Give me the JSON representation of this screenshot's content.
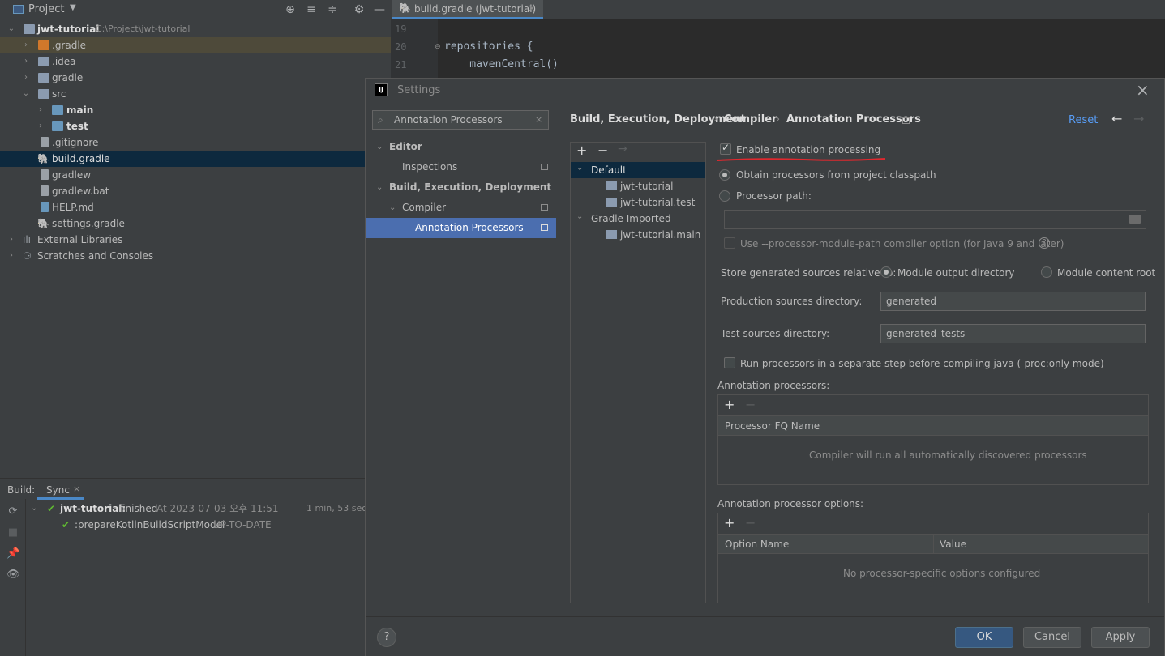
{
  "project_panel": {
    "title": "Project",
    "tree": [
      {
        "label": "jwt-tutorial",
        "path": "C:\\Project\\jwt-tutorial"
      },
      {
        "label": ".gradle"
      },
      {
        "label": ".idea"
      },
      {
        "label": "gradle"
      },
      {
        "label": "src"
      },
      {
        "label": "main"
      },
      {
        "label": "test"
      },
      {
        "label": ".gitignore"
      },
      {
        "label": "build.gradle"
      },
      {
        "label": "gradlew"
      },
      {
        "label": "gradlew.bat"
      },
      {
        "label": "HELP.md"
      },
      {
        "label": "settings.gradle"
      },
      {
        "label": "External Libraries"
      },
      {
        "label": "Scratches and Consoles"
      }
    ]
  },
  "editor": {
    "tab_label": "build.gradle (jwt-tutorial)",
    "lines": [
      {
        "num": "19",
        "code": ""
      },
      {
        "num": "20",
        "code": "repositories {"
      },
      {
        "num": "21",
        "code": "    mavenCentral()"
      }
    ]
  },
  "build_panel": {
    "label": "Build:",
    "tab": "Sync",
    "entries": [
      {
        "name": "jwt-tutorial:",
        "status": "finished",
        "detail": "At 2023-07-03 오후 11:51",
        "time": "1 min, 53 sec,"
      },
      {
        "name": ":prepareKotlinBuildScriptModel",
        "status": "UP-TO-DATE"
      }
    ]
  },
  "settings": {
    "title": "Settings",
    "search": {
      "value": "Annotation Processors"
    },
    "sidebar": {
      "editor": "Editor",
      "inspections": "Inspections",
      "build": "Build, Execution, Deployment",
      "compiler": "Compiler",
      "annotation_processors": "Annotation Processors"
    },
    "breadcrumb": [
      "Build, Execution, Deployment",
      "Compiler",
      "Annotation Processors"
    ],
    "reset": "Reset",
    "profiles": [
      {
        "label": "Default"
      },
      {
        "label": "jwt-tutorial"
      },
      {
        "label": "jwt-tutorial.test"
      },
      {
        "label": "Gradle Imported"
      },
      {
        "label": "jwt-tutorial.main"
      }
    ],
    "enable_label": "Enable annotation processing",
    "enable_checked": true,
    "obtain_label": "Obtain processors from project classpath",
    "processor_path_label": "Processor path:",
    "processor_path_value": "",
    "module_path_label": "Use --processor-module-path compiler option (for Java 9 and later)",
    "store_label": "Store generated sources relative to:",
    "module_output": "Module output directory",
    "module_content": "Module content root",
    "prod_label": "Production sources directory:",
    "prod_value": "generated",
    "test_label": "Test sources directory:",
    "test_value": "generated_tests",
    "run_separate_label": "Run processors in a separate step before compiling java (-proc:only mode)",
    "processors_title": "Annotation processors:",
    "processors_col": "Processor FQ Name",
    "processors_empty": "Compiler will run all automatically discovered processors",
    "options_title": "Annotation processor options:",
    "options_col_name": "Option Name",
    "options_col_value": "Value",
    "options_empty": "No processor-specific options configured",
    "ok": "OK",
    "cancel": "Cancel",
    "apply": "Apply",
    "help": "?"
  },
  "colors": {
    "accent": "#4b6eaf",
    "annotation_underline": "#e0282e",
    "success": "#5fb832",
    "link": "#589df6"
  }
}
